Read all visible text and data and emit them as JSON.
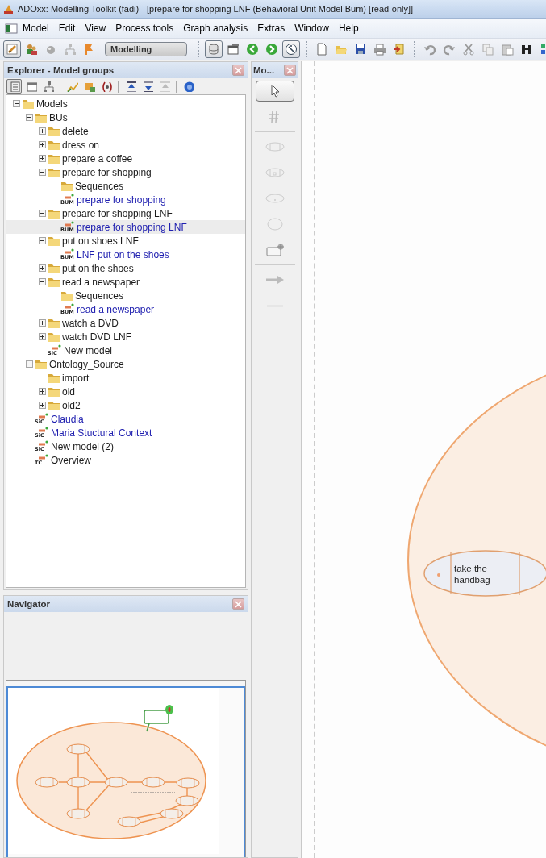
{
  "window": {
    "title": "ADOxx: Modelling Toolkit (fadi) - [prepare for shopping LNF (Behavioral Unit Model Bum) [read-only]]"
  },
  "menu": [
    "Model",
    "Edit",
    "View",
    "Process tools",
    "Graph analysis",
    "Extras",
    "Window",
    "Help"
  ],
  "toolbar": {
    "groups": [
      [
        {
          "pressed": true
        },
        {
          "pressed": false
        },
        {
          "pressed": false
        },
        {
          "pressed": false
        },
        {
          "pressed": false
        }
      ],
      [
        {
          "pressed": true
        },
        {
          "pressed": false
        },
        {
          "pressed": false
        },
        {
          "pressed": false
        },
        {
          "pressed": true
        }
      ],
      [
        {
          "pressed": false
        },
        {
          "pressed": false
        },
        {
          "pressed": false
        },
        {
          "pressed": false
        },
        {
          "pressed": false
        }
      ],
      [
        {
          "pressed": false
        },
        {
          "pressed": false
        },
        {
          "pressed": false
        },
        {
          "pressed": false
        },
        {
          "pressed": false
        },
        {
          "pressed": false
        },
        {
          "pressed": false
        }
      ]
    ],
    "mode": "Modelling"
  },
  "explorer": {
    "title": "Explorer - Model groups",
    "toolbar": [
      {
        "pressed": true
      },
      {
        "pressed": false
      },
      {
        "pressed": false
      },
      {
        "pressed": false
      },
      {
        "pressed": false
      },
      {
        "pressed": false
      },
      {
        "pressed": false
      },
      {
        "pressed": false
      },
      {
        "pressed": false
      },
      {
        "pressed": false
      }
    ],
    "tree": [
      {
        "kind": "folder",
        "label": "Models",
        "expanded": true,
        "selected": false,
        "children": [
          {
            "kind": "folder",
            "label": "BUs",
            "expanded": true,
            "selected": false,
            "children": [
              {
                "kind": "folder",
                "label": "delete",
                "expanded": false,
                "selected": false
              },
              {
                "kind": "folder",
                "label": "dress on",
                "expanded": false,
                "selected": false
              },
              {
                "kind": "folder",
                "label": "prepare a coffee",
                "expanded": false,
                "selected": false
              },
              {
                "kind": "folder",
                "label": "prepare for shopping",
                "expanded": true,
                "selected": false,
                "children": [
                  {
                    "kind": "folder",
                    "label": "Sequences",
                    "selected": false
                  },
                  {
                    "kind": "model",
                    "badge": "BUM",
                    "label": "prepare for shopping",
                    "open": true,
                    "selected": false
                  }
                ]
              },
              {
                "kind": "folder",
                "label": "prepare for shopping LNF",
                "expanded": true,
                "selected": false,
                "children": [
                  {
                    "kind": "model",
                    "badge": "BUM",
                    "label": "prepare for shopping LNF",
                    "open": true,
                    "selected": true
                  }
                ]
              },
              {
                "kind": "folder",
                "label": "put on shoes LNF",
                "expanded": true,
                "selected": false,
                "children": [
                  {
                    "kind": "model",
                    "badge": "BUM",
                    "label": "LNF put on the shoes",
                    "open": true,
                    "selected": false
                  }
                ]
              },
              {
                "kind": "folder",
                "label": "put on the shoes",
                "expanded": false,
                "selected": false
              },
              {
                "kind": "folder",
                "label": "read a newspaper",
                "expanded": true,
                "selected": false,
                "children": [
                  {
                    "kind": "folder",
                    "label": "Sequences",
                    "selected": false
                  },
                  {
                    "kind": "model",
                    "badge": "BUM",
                    "label": "read a newspaper",
                    "open": true,
                    "selected": false
                  }
                ]
              },
              {
                "kind": "folder",
                "label": "watch a DVD",
                "expanded": false,
                "selected": false
              },
              {
                "kind": "folder",
                "label": "watch DVD LNF",
                "expanded": false,
                "selected": false
              },
              {
                "kind": "model",
                "badge": "SiC",
                "label": "New model",
                "open": false,
                "selected": false
              }
            ]
          },
          {
            "kind": "folder",
            "label": "Ontology_Source",
            "expanded": true,
            "selected": false,
            "children": [
              {
                "kind": "folder",
                "label": "import",
                "selected": false
              },
              {
                "kind": "folder",
                "label": "old",
                "expanded": false,
                "selected": false
              },
              {
                "kind": "folder",
                "label": "old2",
                "expanded": false,
                "selected": false
              }
            ]
          },
          {
            "kind": "model",
            "badge": "SiC",
            "label": "Claudia",
            "open": true,
            "selected": false
          },
          {
            "kind": "model",
            "badge": "SiC",
            "label": "Maria Stuctural  Context",
            "open": true,
            "selected": false
          },
          {
            "kind": "model",
            "badge": "SiC",
            "label": "New model (2)",
            "open": false,
            "selected": false
          },
          {
            "kind": "model",
            "badge": "TC",
            "label": "Overview",
            "open": false,
            "selected": false
          }
        ]
      }
    ]
  },
  "palette": {
    "title": "Mo...",
    "tools": [
      {
        "pressed": true
      },
      {
        "pressed": false
      },
      {
        "pressed": false
      },
      {
        "pressed": false
      },
      {
        "pressed": false
      },
      {
        "pressed": false
      },
      {
        "pressed": false
      },
      {
        "pressed": false
      },
      {
        "pressed": false
      }
    ]
  },
  "canvas": {
    "nodes": [
      {
        "label": "take the\nhandbag"
      }
    ]
  },
  "navigator": {
    "title": "Navigator"
  }
}
